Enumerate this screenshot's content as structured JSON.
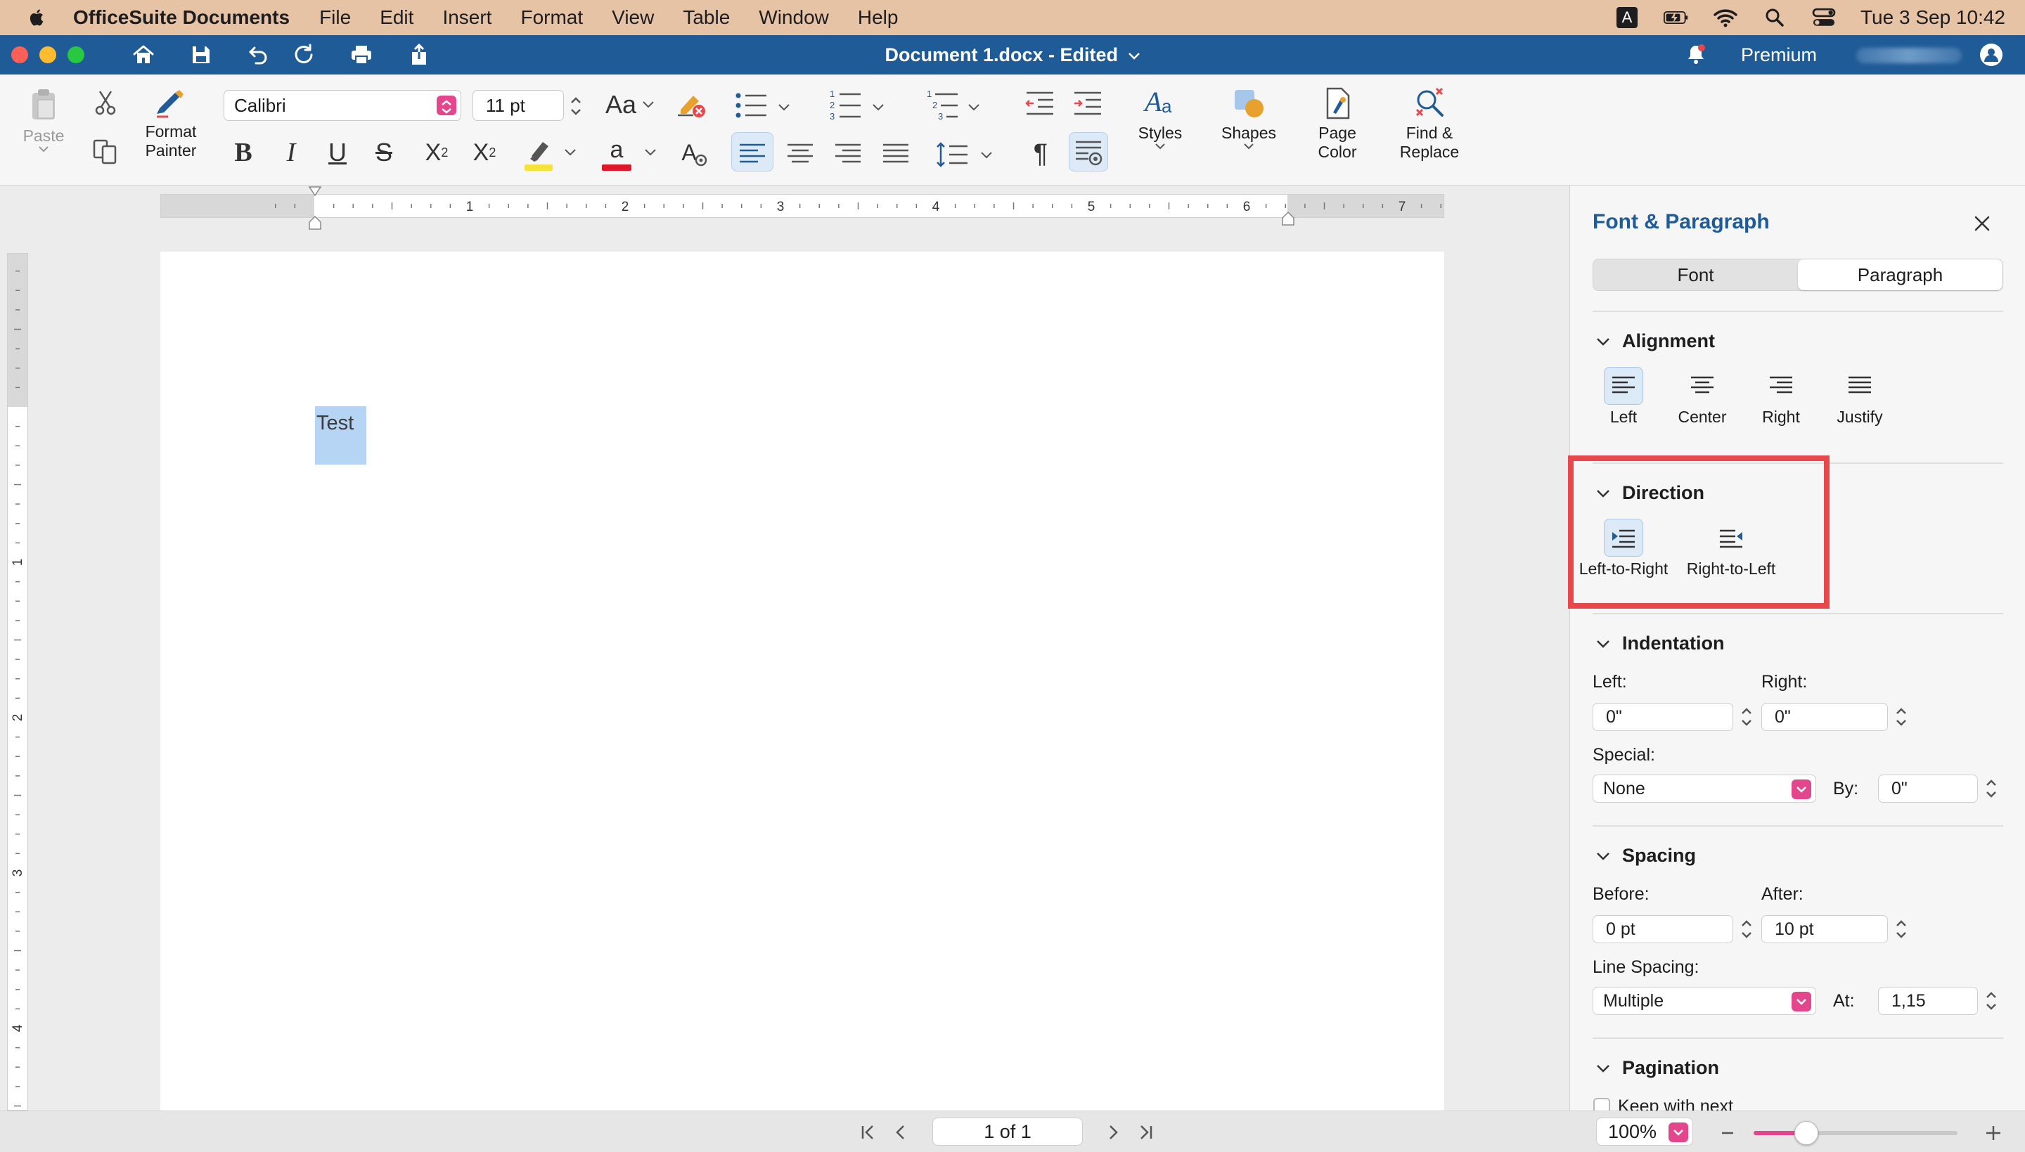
{
  "menubar": {
    "app_name": "OfficeSuite Documents",
    "items": [
      "File",
      "Edit",
      "Insert",
      "Format",
      "View",
      "Table",
      "Window",
      "Help"
    ],
    "input_indicator": "A",
    "clock": "Tue 3 Sep  10:42"
  },
  "titlebar": {
    "document_title": "Document 1.docx - Edited",
    "premium_label": "Premium"
  },
  "ribbon": {
    "paste_label": "Paste",
    "format_painter_label": "Format Painter",
    "font_name": "Calibri",
    "font_size": "11 pt",
    "styles_label": "Styles",
    "shapes_label": "Shapes",
    "page_color_label": "Page Color",
    "find_replace_label": "Find & Replace",
    "case_label": "Aa",
    "pilcrow": "¶"
  },
  "document": {
    "text": "Test",
    "ruler_numbers": [
      "1",
      "2",
      "3",
      "4",
      "5",
      "6",
      "7"
    ],
    "vruler_numbers": [
      "1",
      "2",
      "3",
      "4"
    ]
  },
  "pane": {
    "title": "Font & Paragraph",
    "tabs": [
      "Font",
      "Paragraph"
    ],
    "active_tab": "Paragraph",
    "alignment": {
      "heading": "Alignment",
      "options": [
        "Left",
        "Center",
        "Right",
        "Justify"
      ],
      "selected": "Left"
    },
    "direction": {
      "heading": "Direction",
      "options": [
        "Left-to-Right",
        "Right-to-Left"
      ],
      "selected": "Left-to-Right"
    },
    "indentation": {
      "heading": "Indentation",
      "left_label": "Left:",
      "left_value": "0\"",
      "right_label": "Right:",
      "right_value": "0\"",
      "special_label": "Special:",
      "special_value": "None",
      "by_label": "By:",
      "by_value": "0\""
    },
    "spacing": {
      "heading": "Spacing",
      "before_label": "Before:",
      "before_value": "0 pt",
      "after_label": "After:",
      "after_value": "10 pt",
      "line_spacing_label": "Line Spacing:",
      "line_spacing_value": "Multiple",
      "at_label": "At:",
      "at_value": "1,15"
    },
    "pagination": {
      "heading": "Pagination",
      "keep_with_next": "Keep with next"
    }
  },
  "statusbar": {
    "page_indicator": "1 of 1",
    "zoom": "100%",
    "zoom_level_fraction": 0.26
  },
  "colors": {
    "title_bar": "#1f5b97",
    "menubar": "#e7c3a6",
    "accent_pink": "#e3468c",
    "highlight_red": "#e8474b",
    "selection": "#b6d5f5"
  }
}
